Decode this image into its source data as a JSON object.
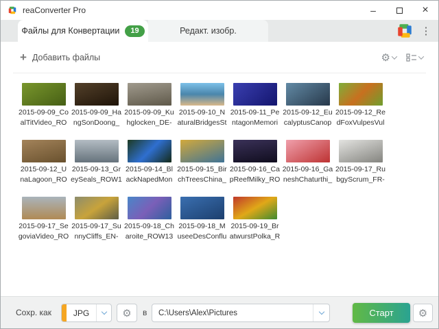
{
  "window": {
    "title": "reaConverter Pro",
    "controls": {
      "minimize": "–",
      "close": "×"
    }
  },
  "tabs": {
    "active": {
      "label": "Файлы для Конвертации",
      "count": "19"
    },
    "inactive": {
      "label": "Редакт. изобр."
    }
  },
  "toolbar": {
    "add_files_label": "Добавить файлы",
    "plus_glyph": "+",
    "gear_glyph": "⚙",
    "kebab_glyph": "⋮"
  },
  "files": [
    {
      "line1": "2015-09-09_Co",
      "line2": "alTitVideo_RO",
      "angle": "150deg",
      "colors": [
        "#79962c",
        "#465f15"
      ]
    },
    {
      "line1": "2015-09-09_Ha",
      "line2": "ngSonDoong_",
      "angle": "160deg",
      "colors": [
        "#53402a",
        "#1f1408"
      ]
    },
    {
      "line1": "2015-09-09_Ku",
      "line2": "hglocken_DE-",
      "angle": "170deg",
      "colors": [
        "#a09a8d",
        "#5f594a"
      ]
    },
    {
      "line1": "2015-09-10_N",
      "line2": "aturalBridgesSt",
      "angle": "180deg",
      "colors": [
        "#7dc0e8",
        "#4a86ac",
        "#d9b98a"
      ]
    },
    {
      "line1": "2015-09-11_Pe",
      "line2": "ntagonMemori",
      "angle": "135deg",
      "colors": [
        "#3a3fb0",
        "#13156e"
      ]
    },
    {
      "line1": "2015-09-12_Eu",
      "line2": "calyptusCanop",
      "angle": "145deg",
      "colors": [
        "#628aa5",
        "#27384a"
      ]
    },
    {
      "line1": "2015-09-12_Re",
      "line2": "dFoxVulpesVul",
      "angle": "135deg",
      "colors": [
        "#7fae3a",
        "#c8701f",
        "#6f9e2e"
      ]
    },
    {
      "line1": "2015-09-12_U",
      "line2": "naLagoon_RO",
      "angle": "165deg",
      "colors": [
        "#a3835a",
        "#69512e"
      ]
    },
    {
      "line1": "2015-09-13_Gr",
      "line2": "eySeals_ROW1",
      "angle": "180deg",
      "colors": [
        "#b3bcc3",
        "#66737c"
      ]
    },
    {
      "line1": "2015-09-14_Bl",
      "line2": "ackNapedMon",
      "angle": "135deg",
      "colors": [
        "#1d3a22",
        "#2f6fd0",
        "#142a18"
      ]
    },
    {
      "line1": "2015-09-15_Bir",
      "line2": "chTreesChina_",
      "angle": "160deg",
      "colors": [
        "#d2a93c",
        "#3f7396"
      ]
    },
    {
      "line1": "2015-09-16_Ca",
      "line2": "pReefMilky_RO",
      "angle": "170deg",
      "colors": [
        "#3a3158",
        "#100d1e"
      ]
    },
    {
      "line1": "2015-09-16_Ga",
      "line2": "neshChaturthi_",
      "angle": "150deg",
      "colors": [
        "#f0a0ac",
        "#bd3232"
      ]
    },
    {
      "line1": "2015-09-17_Ru",
      "line2": "bgyScrum_FR-",
      "angle": "160deg",
      "colors": [
        "#e3e3e0",
        "#84847f"
      ]
    },
    {
      "line1": "2015-09-17_Se",
      "line2": "goviaVideo_RO",
      "angle": "180deg",
      "colors": [
        "#aab4bb",
        "#b08a54"
      ]
    },
    {
      "line1": "2015-09-17_Su",
      "line2": "nnyCliffs_EN-",
      "angle": "145deg",
      "colors": [
        "#8d8d6c",
        "#c8a33b",
        "#5e5e46"
      ]
    },
    {
      "line1": "2015-09-18_Ch",
      "line2": "aroite_ROW13",
      "angle": "135deg",
      "colors": [
        "#4a86c8",
        "#7a5fb8",
        "#2e5f9e"
      ]
    },
    {
      "line1": "2015-09-18_M",
      "line2": "useeDesConflu",
      "angle": "155deg",
      "colors": [
        "#3a6fb0",
        "#1c3f6e"
      ]
    },
    {
      "line1": "2015-09-19_Br",
      "line2": "atwurstPolka_R",
      "angle": "150deg",
      "colors": [
        "#c0392b",
        "#e0a818",
        "#3e8a30"
      ]
    }
  ],
  "footer": {
    "save_as_label": "Сохр. как",
    "format_value": "JPG",
    "in_label": "в",
    "path_value": "C:\\Users\\Alex\\Pictures",
    "start_label": "Старт",
    "gear_glyph": "⚙"
  },
  "colors": {
    "badge_green": "#43a047",
    "start_gradient_left": "#61b945",
    "start_gradient_right": "#2aa391",
    "format_stripe_orange": "#f5a623"
  }
}
